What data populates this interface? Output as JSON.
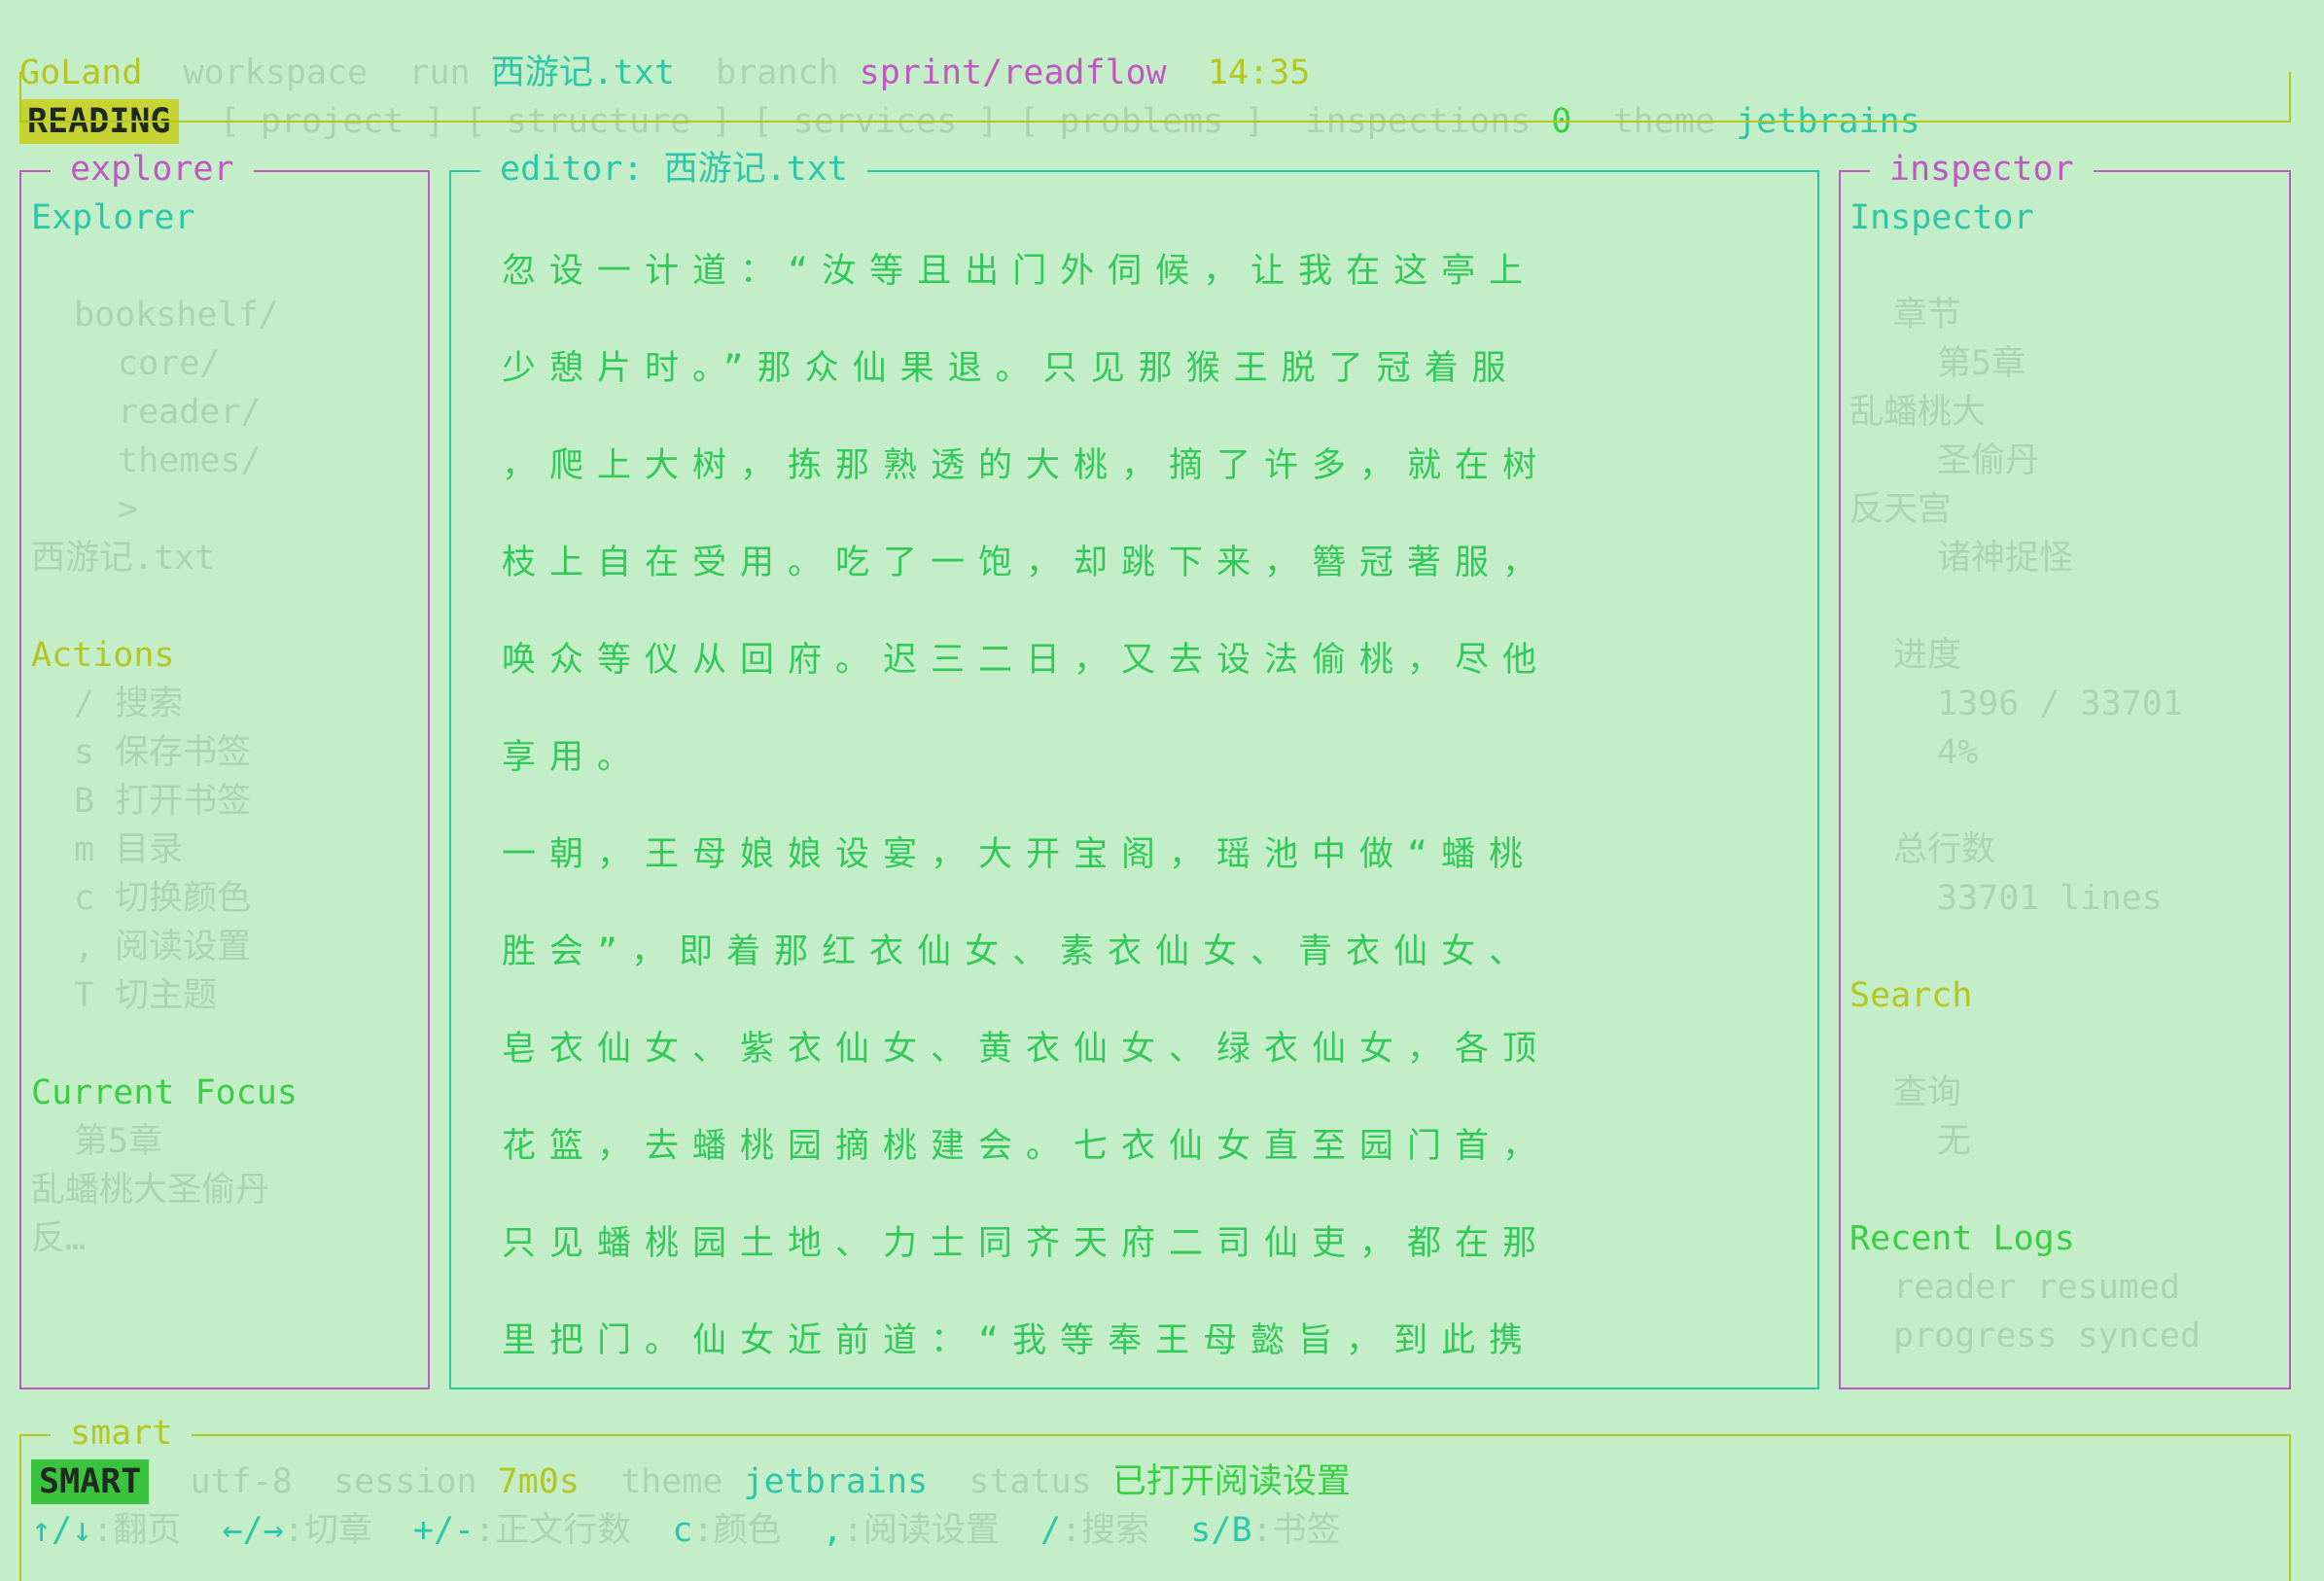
{
  "top": {
    "ide": "GoLand",
    "workspace_label": "workspace",
    "run_label": "run",
    "run_file": "西游记.txt",
    "branch_label": "branch",
    "branch": "sprint/readflow",
    "time": "14:35",
    "mode": "READING",
    "tabs": [
      "[ project ]",
      "[ structure ]",
      "[ services ]",
      "[ problems ]"
    ],
    "inspections_label": "inspections",
    "inspections_count": "0",
    "theme_label": "theme",
    "theme": "jetbrains"
  },
  "explorer": {
    "title": "explorer",
    "heading": "Explorer",
    "tree": [
      "bookshelf/",
      "core/",
      "reader/",
      "themes/",
      ">",
      "西游记.txt"
    ],
    "actions_heading": "Actions",
    "actions": [
      "/ 搜索",
      "s 保存书签",
      "B 打开书签",
      "m 目录",
      "c 切换颜色",
      ", 阅读设置",
      "T 切主题"
    ],
    "focus_heading": "Current Focus",
    "focus_lines": [
      "第5章",
      "乱蟠桃大圣偷丹",
      "反…"
    ]
  },
  "editor": {
    "title": "editor: 西游记.txt",
    "lines": [
      "忽设一计道：“汝等且出门外伺候，让我在这亭上",
      "少憩片时。”那众仙果退。只见那猴王脱了冠着服",
      "，爬上大树，拣那熟透的大桃，摘了许多，就在树",
      "枝上自在受用。吃了一饱，却跳下来，簪冠著服，",
      "唤众等仪从回府。迟三二日，又去设法偷桃，尽他",
      "享用。",
      "一朝，王母娘娘设宴，大开宝阁，瑶池中做“蟠桃",
      "胜会”，即着那红衣仙女、素衣仙女、青衣仙女、",
      "皂衣仙女、紫衣仙女、黄衣仙女、绿衣仙女，各顶",
      "花篮，去蟠桃园摘桃建会。七衣仙女直至园门首，",
      "只见蟠桃园土地、力士同齐天府二司仙吏，都在那",
      "里把门。仙女近前道：“我等奉王母懿旨，到此携"
    ]
  },
  "inspector": {
    "title": "inspector",
    "heading": "Inspector",
    "chapter_label": "章节",
    "chapter_lines": [
      "第5章",
      "乱蟠桃大",
      "圣偷丹",
      "反天宫",
      "诸神捉怪"
    ],
    "progress_label": "进度",
    "progress_value": "1396 / 33701",
    "progress_percent": "4%",
    "total_label": "总行数",
    "total_value": "33701 lines",
    "search_heading": "Search",
    "query_label": "查询",
    "query_value": "无",
    "logs_heading": "Recent Logs",
    "logs": [
      "reader resumed",
      "progress synced"
    ]
  },
  "status": {
    "title": "smart",
    "mode": "SMART",
    "encoding": "utf-8",
    "session_label": "session",
    "session": "7m0s",
    "theme_label": "theme",
    "theme": "jetbrains",
    "status_label": "status",
    "status": "已打开阅读设置",
    "hints": [
      {
        "key": "↑/↓",
        "desc": ":翻页"
      },
      {
        "key": "←/→",
        "desc": ":切章"
      },
      {
        "key": "+/-",
        "desc": ":正文行数"
      },
      {
        "key": "c",
        "desc": ":颜色"
      },
      {
        "key": ",",
        "desc": ":阅读设置"
      },
      {
        "key": "/",
        "desc": ":搜索"
      },
      {
        "key": "s/B",
        "desc": ":书签"
      }
    ]
  },
  "colors": {
    "background": "#c4eec8",
    "dim_text": "#a9d4ae",
    "teal": "#2cc7a8",
    "magenta": "#c057c2",
    "yellow": "#b5c622",
    "green": "#38cf42"
  }
}
